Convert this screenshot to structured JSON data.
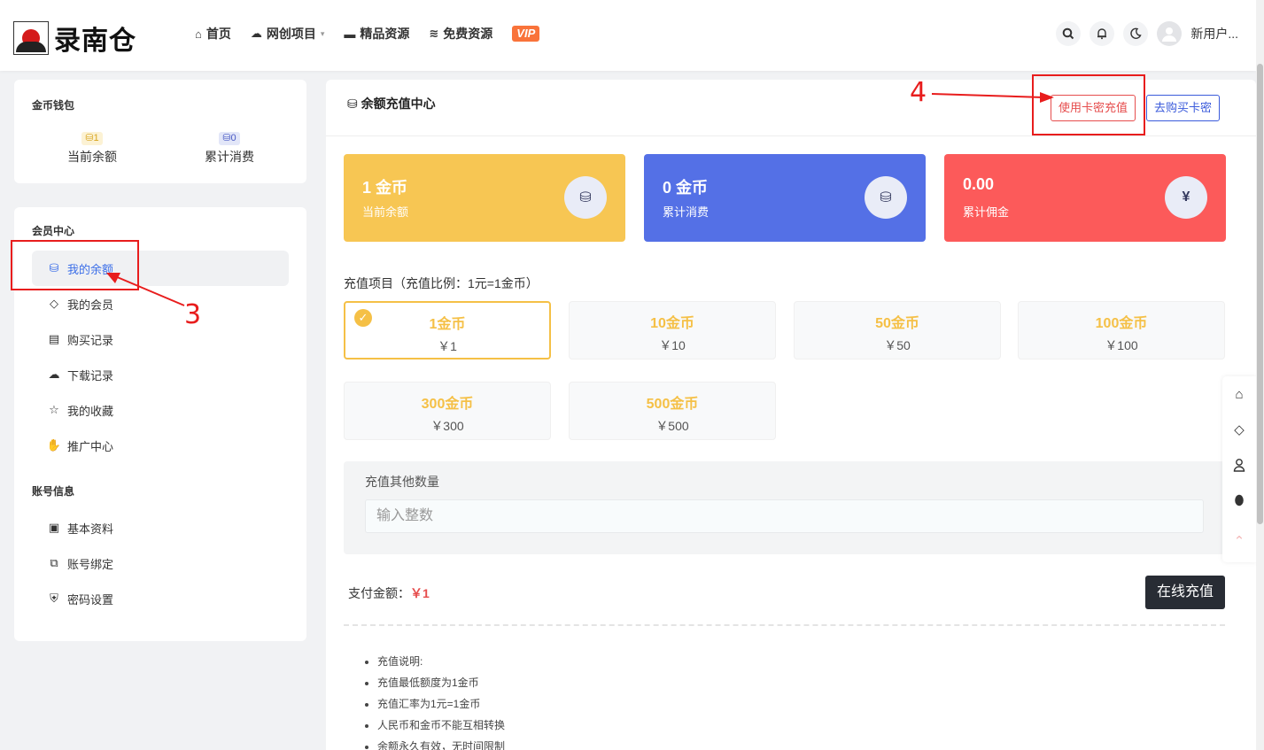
{
  "header": {
    "logo_text": "录南仓",
    "nav": [
      {
        "label": "首页",
        "icon": "home-icon"
      },
      {
        "label": "网创项目",
        "icon": "cloud-icon",
        "dropdown": true
      },
      {
        "label": "精品资源",
        "icon": "folder-icon"
      },
      {
        "label": "免费资源",
        "icon": "layers-icon"
      }
    ],
    "vip": "VIP",
    "username": "新用户..."
  },
  "wallet": {
    "title": "金币钱包",
    "balance_chip": "1",
    "balance_label": "当前余额",
    "spent_chip": "0",
    "spent_label": "累计消费"
  },
  "menu": {
    "member_title": "会员中心",
    "items": [
      {
        "label": "我的余额",
        "icon": "coins-icon",
        "active": true
      },
      {
        "label": "我的会员",
        "icon": "diamond-icon"
      },
      {
        "label": "购买记录",
        "icon": "basket-icon"
      },
      {
        "label": "下载记录",
        "icon": "cloud-download-icon"
      },
      {
        "label": "我的收藏",
        "icon": "star-icon"
      },
      {
        "label": "推广中心",
        "icon": "hand-coin-icon"
      }
    ],
    "account_title": "账号信息",
    "account_items": [
      {
        "label": "基本资料",
        "icon": "id-card-icon"
      },
      {
        "label": "账号绑定",
        "icon": "link-icon"
      },
      {
        "label": "密码设置",
        "icon": "shield-icon"
      }
    ]
  },
  "main": {
    "title": "余额充值中心",
    "card_recharge_btn": "使用卡密充值",
    "buy_card_btn": "去购买卡密",
    "stats": [
      {
        "value": "1 金币",
        "label": "当前余额",
        "color": "#f7c653",
        "icon": "¥"
      },
      {
        "value": "0 金币",
        "label": "累计消费",
        "color": "#5470e6",
        "icon": "¥"
      },
      {
        "value": "0.00",
        "label": "累计佣金",
        "color": "#fc5a5a",
        "icon": "¥"
      }
    ],
    "recharge_title": "充值项目（充值比例：1元=1金币）",
    "options": [
      {
        "coins": "1金币",
        "price": "￥1",
        "selected": true
      },
      {
        "coins": "10金币",
        "price": "￥10"
      },
      {
        "coins": "50金币",
        "price": "￥50"
      },
      {
        "coins": "100金币",
        "price": "￥100"
      },
      {
        "coins": "300金币",
        "price": "￥300"
      },
      {
        "coins": "500金币",
        "price": "￥500"
      }
    ],
    "other_title": "充值其他数量",
    "other_placeholder": "输入整数",
    "pay_label": "支付金额：",
    "pay_amount": "￥1",
    "pay_button": "在线充值",
    "notes": [
      "充值说明:",
      "充值最低额度为1金币",
      "充值汇率为1元=1金币",
      "人民币和金币不能互相转换",
      "余额永久有效，无时间限制"
    ]
  },
  "annotations": {
    "step3": "3",
    "step4": "4",
    "color": "#e81d1d"
  }
}
